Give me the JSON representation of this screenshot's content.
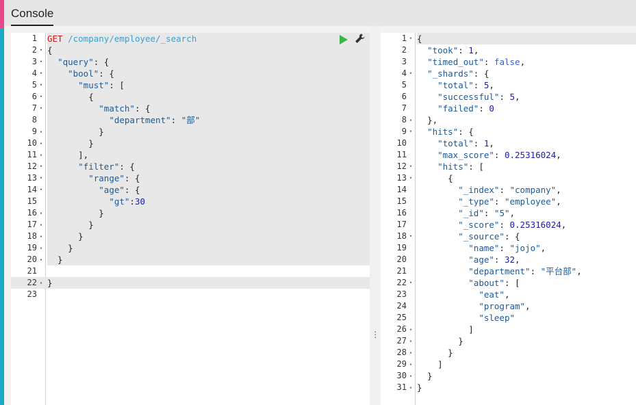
{
  "header": {
    "tab_label": "Console"
  },
  "colors": {
    "accent_pink": "#e8488a",
    "accent_teal": "#1ba9c8",
    "run_green": "#3cb44b"
  },
  "icons": {
    "run": "play-icon",
    "settings": "wrench-icon",
    "resize": "vertical-dots-icon"
  },
  "request": {
    "lines": [
      {
        "n": "1",
        "fold": "",
        "html": "<span class=\"m\">GET</span> <span class=\"u\">/company/employee/_search</span>"
      },
      {
        "n": "2",
        "fold": "▾",
        "html": "{"
      },
      {
        "n": "3",
        "fold": "▾",
        "html": "  <span class=\"k\">\"query\"</span>: {"
      },
      {
        "n": "4",
        "fold": "▾",
        "html": "    <span class=\"k\">\"bool\"</span>: {"
      },
      {
        "n": "5",
        "fold": "▾",
        "html": "      <span class=\"k\">\"must\"</span>: ["
      },
      {
        "n": "6",
        "fold": "▾",
        "html": "        {"
      },
      {
        "n": "7",
        "fold": "▾",
        "html": "          <span class=\"k\">\"match\"</span>: {"
      },
      {
        "n": "8",
        "fold": "",
        "html": "            <span class=\"k\">\"department\"</span>: <span class=\"s\">\"部\"</span>"
      },
      {
        "n": "9",
        "fold": "▴",
        "html": "          }"
      },
      {
        "n": "10",
        "fold": "▴",
        "html": "        }"
      },
      {
        "n": "11",
        "fold": "▴",
        "html": "      ],"
      },
      {
        "n": "12",
        "fold": "▾",
        "html": "      <span class=\"k\">\"filter\"</span>: {"
      },
      {
        "n": "13",
        "fold": "▾",
        "html": "        <span class=\"k\">\"range\"</span>: {"
      },
      {
        "n": "14",
        "fold": "▾",
        "html": "          <span class=\"k\">\"age\"</span>: {"
      },
      {
        "n": "15",
        "fold": "",
        "html": "            <span class=\"k\">\"gt\"</span>:<span class=\"n\">30</span>"
      },
      {
        "n": "16",
        "fold": "▴",
        "html": "          }"
      },
      {
        "n": "17",
        "fold": "▴",
        "html": "        }"
      },
      {
        "n": "18",
        "fold": "▴",
        "html": "      }"
      },
      {
        "n": "19",
        "fold": "▴",
        "html": "    }"
      },
      {
        "n": "20",
        "fold": "▴",
        "html": "  }"
      },
      {
        "n": "21",
        "fold": "",
        "html": ""
      },
      {
        "n": "22",
        "fold": "▴",
        "html": "}"
      },
      {
        "n": "23",
        "fold": "",
        "html": ""
      }
    ]
  },
  "response": {
    "lines": [
      {
        "n": "1",
        "fold": "▾",
        "html": "{"
      },
      {
        "n": "2",
        "fold": "",
        "html": "  <span class=\"k\">\"took\"</span>: <span class=\"n\">1</span>,"
      },
      {
        "n": "3",
        "fold": "",
        "html": "  <span class=\"k\">\"timed_out\"</span>: <span class=\"b\">false</span>,"
      },
      {
        "n": "4",
        "fold": "▾",
        "html": "  <span class=\"k\">\"_shards\"</span>: {"
      },
      {
        "n": "5",
        "fold": "",
        "html": "    <span class=\"k\">\"total\"</span>: <span class=\"n\">5</span>,"
      },
      {
        "n": "6",
        "fold": "",
        "html": "    <span class=\"k\">\"successful\"</span>: <span class=\"n\">5</span>,"
      },
      {
        "n": "7",
        "fold": "",
        "html": "    <span class=\"k\">\"failed\"</span>: <span class=\"n\">0</span>"
      },
      {
        "n": "8",
        "fold": "▴",
        "html": "  },"
      },
      {
        "n": "9",
        "fold": "▾",
        "html": "  <span class=\"k\">\"hits\"</span>: {"
      },
      {
        "n": "10",
        "fold": "",
        "html": "    <span class=\"k\">\"total\"</span>: <span class=\"n\">1</span>,"
      },
      {
        "n": "11",
        "fold": "",
        "html": "    <span class=\"k\">\"max_score\"</span>: <span class=\"n\">0.25316024</span>,"
      },
      {
        "n": "12",
        "fold": "▾",
        "html": "    <span class=\"k\">\"hits\"</span>: ["
      },
      {
        "n": "13",
        "fold": "▾",
        "html": "      {"
      },
      {
        "n": "14",
        "fold": "",
        "html": "        <span class=\"k\">\"_index\"</span>: <span class=\"s\">\"company\"</span>,"
      },
      {
        "n": "15",
        "fold": "",
        "html": "        <span class=\"k\">\"_type\"</span>: <span class=\"s\">\"employee\"</span>,"
      },
      {
        "n": "16",
        "fold": "",
        "html": "        <span class=\"k\">\"_id\"</span>: <span class=\"s\">\"5\"</span>,"
      },
      {
        "n": "17",
        "fold": "",
        "html": "        <span class=\"k\">\"_score\"</span>: <span class=\"n\">0.25316024</span>,"
      },
      {
        "n": "18",
        "fold": "▾",
        "html": "        <span class=\"k\">\"_source\"</span>: {"
      },
      {
        "n": "19",
        "fold": "",
        "html": "          <span class=\"k\">\"name\"</span>: <span class=\"s\">\"jojo\"</span>,"
      },
      {
        "n": "20",
        "fold": "",
        "html": "          <span class=\"k\">\"age\"</span>: <span class=\"n\">32</span>,"
      },
      {
        "n": "21",
        "fold": "",
        "html": "          <span class=\"k\">\"department\"</span>: <span class=\"s\">\"平台部\"</span>,"
      },
      {
        "n": "22",
        "fold": "▾",
        "html": "          <span class=\"k\">\"about\"</span>: ["
      },
      {
        "n": "23",
        "fold": "",
        "html": "            <span class=\"s\">\"eat\"</span>,"
      },
      {
        "n": "24",
        "fold": "",
        "html": "            <span class=\"s\">\"program\"</span>,"
      },
      {
        "n": "25",
        "fold": "",
        "html": "            <span class=\"s\">\"sleep\"</span>"
      },
      {
        "n": "26",
        "fold": "▴",
        "html": "          ]"
      },
      {
        "n": "27",
        "fold": "▴",
        "html": "        }"
      },
      {
        "n": "28",
        "fold": "▴",
        "html": "      }"
      },
      {
        "n": "29",
        "fold": "▴",
        "html": "    ]"
      },
      {
        "n": "30",
        "fold": "▴",
        "html": "  }"
      },
      {
        "n": "31",
        "fold": "▴",
        "html": "}"
      }
    ]
  }
}
